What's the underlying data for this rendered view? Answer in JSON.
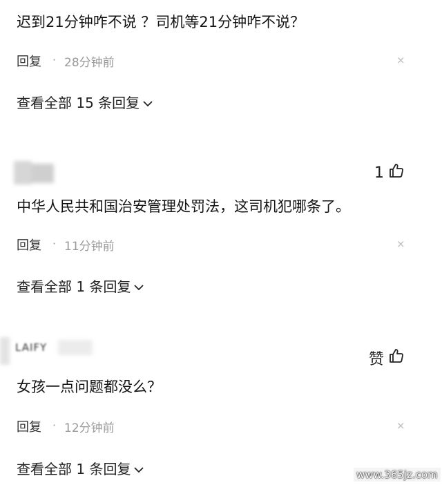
{
  "comments": [
    {
      "text": "迟到21分钟咋不说 ？司机等21分钟咋不说？",
      "reply_label": "回复",
      "dot": "·",
      "time": "28分钟前",
      "close": "×",
      "view_all": "查看全部 15 条回复"
    },
    {
      "like_count": "1",
      "text": "中华人民共和国治安管理处罚法，这司机犯哪条了。",
      "reply_label": "回复",
      "dot": "·",
      "time": "11分钟前",
      "close": "×",
      "view_all": "查看全部 1 条回复"
    },
    {
      "user_name": "LAIFY",
      "like_label": "赞",
      "text": "女孩一点问题都没么？",
      "reply_label": "回复",
      "dot": "·",
      "time": "12分钟前",
      "close": "×",
      "view_all": "查看全部 1 条回复"
    }
  ],
  "watermark": "www.365jz.com",
  "icons": {
    "like": "thumbs-up-icon",
    "expand": "chevron-down-icon",
    "dismiss": "close-icon"
  }
}
